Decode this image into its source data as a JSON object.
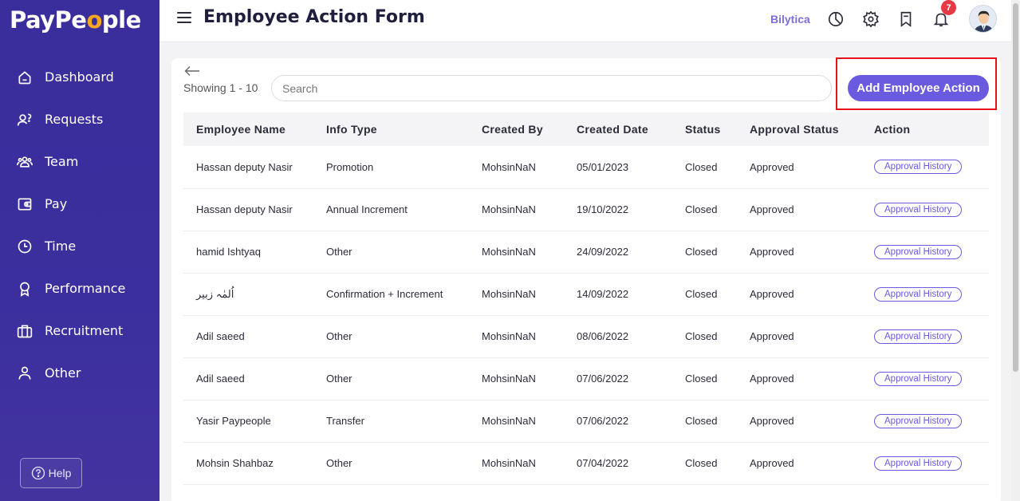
{
  "brand": {
    "logo_pre": "PayPe",
    "logo_o": "o",
    "logo_post": "ple"
  },
  "sidebar": {
    "items": [
      {
        "label": "Dashboard",
        "icon": "home-icon"
      },
      {
        "label": "Requests",
        "icon": "requests-icon"
      },
      {
        "label": "Team",
        "icon": "team-icon"
      },
      {
        "label": "Pay",
        "icon": "wallet-icon"
      },
      {
        "label": "Time",
        "icon": "clock-icon"
      },
      {
        "label": "Performance",
        "icon": "award-icon"
      },
      {
        "label": "Recruitment",
        "icon": "briefcase-icon"
      },
      {
        "label": "Other",
        "icon": "user-icon"
      }
    ],
    "help_label": "Help"
  },
  "header": {
    "title": "Employee Action Form",
    "company": "Bilytica",
    "notification_count": "7"
  },
  "toolbar": {
    "showing": "Showing 1 - 10",
    "search_placeholder": "Search",
    "add_button": "Add Employee Action"
  },
  "table": {
    "columns": [
      "Employee Name",
      "Info Type",
      "Created By",
      "Created Date",
      "Status",
      "Approval Status",
      "Action"
    ],
    "rows": [
      [
        "Hassan deputy Nasir",
        "Promotion",
        "MohsinNaN",
        "05/01/2023",
        "Closed",
        "Approved",
        "Approval History"
      ],
      [
        "Hassan deputy Nasir",
        "Annual Increment",
        "MohsinNaN",
        "19/10/2022",
        "Closed",
        "Approved",
        "Approval History"
      ],
      [
        "hamid Ishtyaq",
        "Other",
        "MohsinNaN",
        "24/09/2022",
        "Closed",
        "Approved",
        "Approval History"
      ],
      [
        "اُلمٰہ زبیر",
        "Confirmation + Increment",
        "MohsinNaN",
        "14/09/2022",
        "Closed",
        "Approved",
        "Approval History"
      ],
      [
        "Adil saeed",
        "Other",
        "MohsinNaN",
        "08/06/2022",
        "Closed",
        "Approved",
        "Approval History"
      ],
      [
        "Adil saeed",
        "Other",
        "MohsinNaN",
        "07/06/2022",
        "Closed",
        "Approved",
        "Approval History"
      ],
      [
        "Yasir Paypeople",
        "Transfer",
        "MohsinNaN",
        "07/06/2022",
        "Closed",
        "Approved",
        "Approval History"
      ],
      [
        "Mohsin Shahbaz",
        "Other",
        "MohsinNaN",
        "07/04/2022",
        "Closed",
        "Approved",
        "Approval History"
      ]
    ]
  },
  "colors": {
    "sidebar": "#3a2e9c",
    "accent": "#6a5ae0",
    "logo_accent": "#f5a623",
    "badge": "#e63946",
    "highlight": "#e8121b"
  }
}
